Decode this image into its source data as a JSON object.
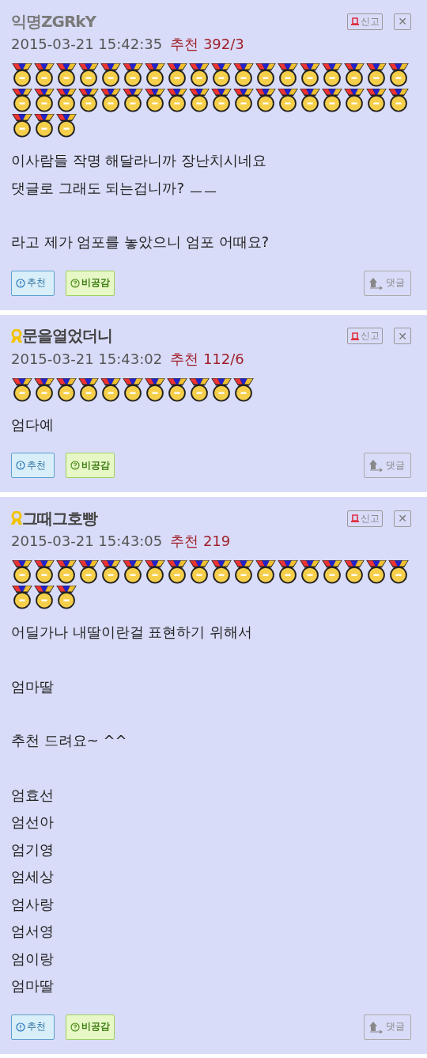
{
  "comments": [
    {
      "author": "익명ZGRkY",
      "anonymous": true,
      "ribbon": false,
      "date": "2015-03-21 15:42:35",
      "recommend": "추천 392/3",
      "medals": [
        {
          "kind": "gold"
        },
        {
          "kind": "gold"
        },
        {
          "kind": "gold"
        },
        {
          "kind": "gold"
        },
        {
          "kind": "gold"
        },
        {
          "kind": "gold"
        },
        {
          "kind": "gold"
        },
        {
          "kind": "gold"
        },
        {
          "kind": "gold"
        },
        {
          "kind": "gold"
        },
        {
          "kind": "gold"
        },
        {
          "kind": "gold"
        },
        {
          "kind": "gold"
        },
        {
          "kind": "gold"
        },
        {
          "kind": "gold"
        },
        {
          "kind": "gold"
        },
        {
          "kind": "gold"
        },
        {
          "kind": "gold"
        },
        {
          "kind": "gold"
        },
        {
          "kind": "gold"
        },
        {
          "kind": "gold"
        },
        {
          "kind": "gold"
        },
        {
          "kind": "gold"
        },
        {
          "kind": "gold"
        },
        {
          "kind": "gold"
        },
        {
          "kind": "gold"
        },
        {
          "kind": "gold"
        },
        {
          "kind": "gold"
        },
        {
          "kind": "gold"
        },
        {
          "kind": "gold"
        },
        {
          "kind": "gold"
        },
        {
          "kind": "gold"
        },
        {
          "kind": "gold"
        },
        {
          "kind": "gold"
        },
        {
          "kind": "gold"
        },
        {
          "kind": "gold"
        },
        {
          "kind": "gold"
        },
        {
          "kind": "gold"
        },
        {
          "kind": "gold"
        }
      ],
      "paragraphs": [
        "이사람들 작명 해달라니까 장난치시네요\n댓글로 그래도 되는겁니까? ㅡㅡ",
        "라고 제가 엄포를 놓았으니 엄포 어때요?"
      ],
      "report_label": "신고",
      "close_label": "✕",
      "upvote_label": "추천",
      "downvote_label": "비공감",
      "reply_label": "댓글"
    },
    {
      "author": "문을열었더니",
      "anonymous": false,
      "ribbon": true,
      "date": "2015-03-21 15:43:02",
      "recommend": "추천 112/6",
      "medals": [
        {
          "kind": "gold"
        },
        {
          "kind": "gold"
        },
        {
          "kind": "gold"
        },
        {
          "kind": "gold"
        },
        {
          "kind": "gold"
        },
        {
          "kind": "gold"
        },
        {
          "kind": "gold"
        },
        {
          "kind": "gold"
        },
        {
          "kind": "gold"
        },
        {
          "kind": "gold"
        },
        {
          "kind": "gold"
        }
      ],
      "paragraphs": [
        "엄다예"
      ],
      "report_label": "신고",
      "close_label": "✕",
      "upvote_label": "추천",
      "downvote_label": "비공감",
      "reply_label": "댓글"
    },
    {
      "author": "그때그호빵",
      "anonymous": false,
      "ribbon": true,
      "date": "2015-03-21 15:43:05",
      "recommend": "추천 219",
      "medals": [
        {
          "kind": "gold"
        },
        {
          "kind": "gold"
        },
        {
          "kind": "gold"
        },
        {
          "kind": "gold"
        },
        {
          "kind": "gold"
        },
        {
          "kind": "gold"
        },
        {
          "kind": "gold"
        },
        {
          "kind": "gold"
        },
        {
          "kind": "gold"
        },
        {
          "kind": "gold"
        },
        {
          "kind": "gold"
        },
        {
          "kind": "gold"
        },
        {
          "kind": "gold"
        },
        {
          "kind": "gold"
        },
        {
          "kind": "gold"
        },
        {
          "kind": "gold"
        },
        {
          "kind": "gold"
        },
        {
          "kind": "gold"
        },
        {
          "kind": "gold"
        },
        {
          "kind": "gold"
        },
        {
          "kind": "gold"
        }
      ],
      "paragraphs": [
        "어딜가나 내딸이란걸 표현하기 위해서",
        "엄마딸",
        "추천 드려요~ ^^",
        "엄효선\n엄선아\n엄기영\n엄세상\n엄사랑\n엄서영\n엄이랑\n엄마딸"
      ],
      "report_label": "신고",
      "close_label": "✕",
      "upvote_label": "추천",
      "downvote_label": "비공감",
      "reply_label": "댓글"
    }
  ]
}
